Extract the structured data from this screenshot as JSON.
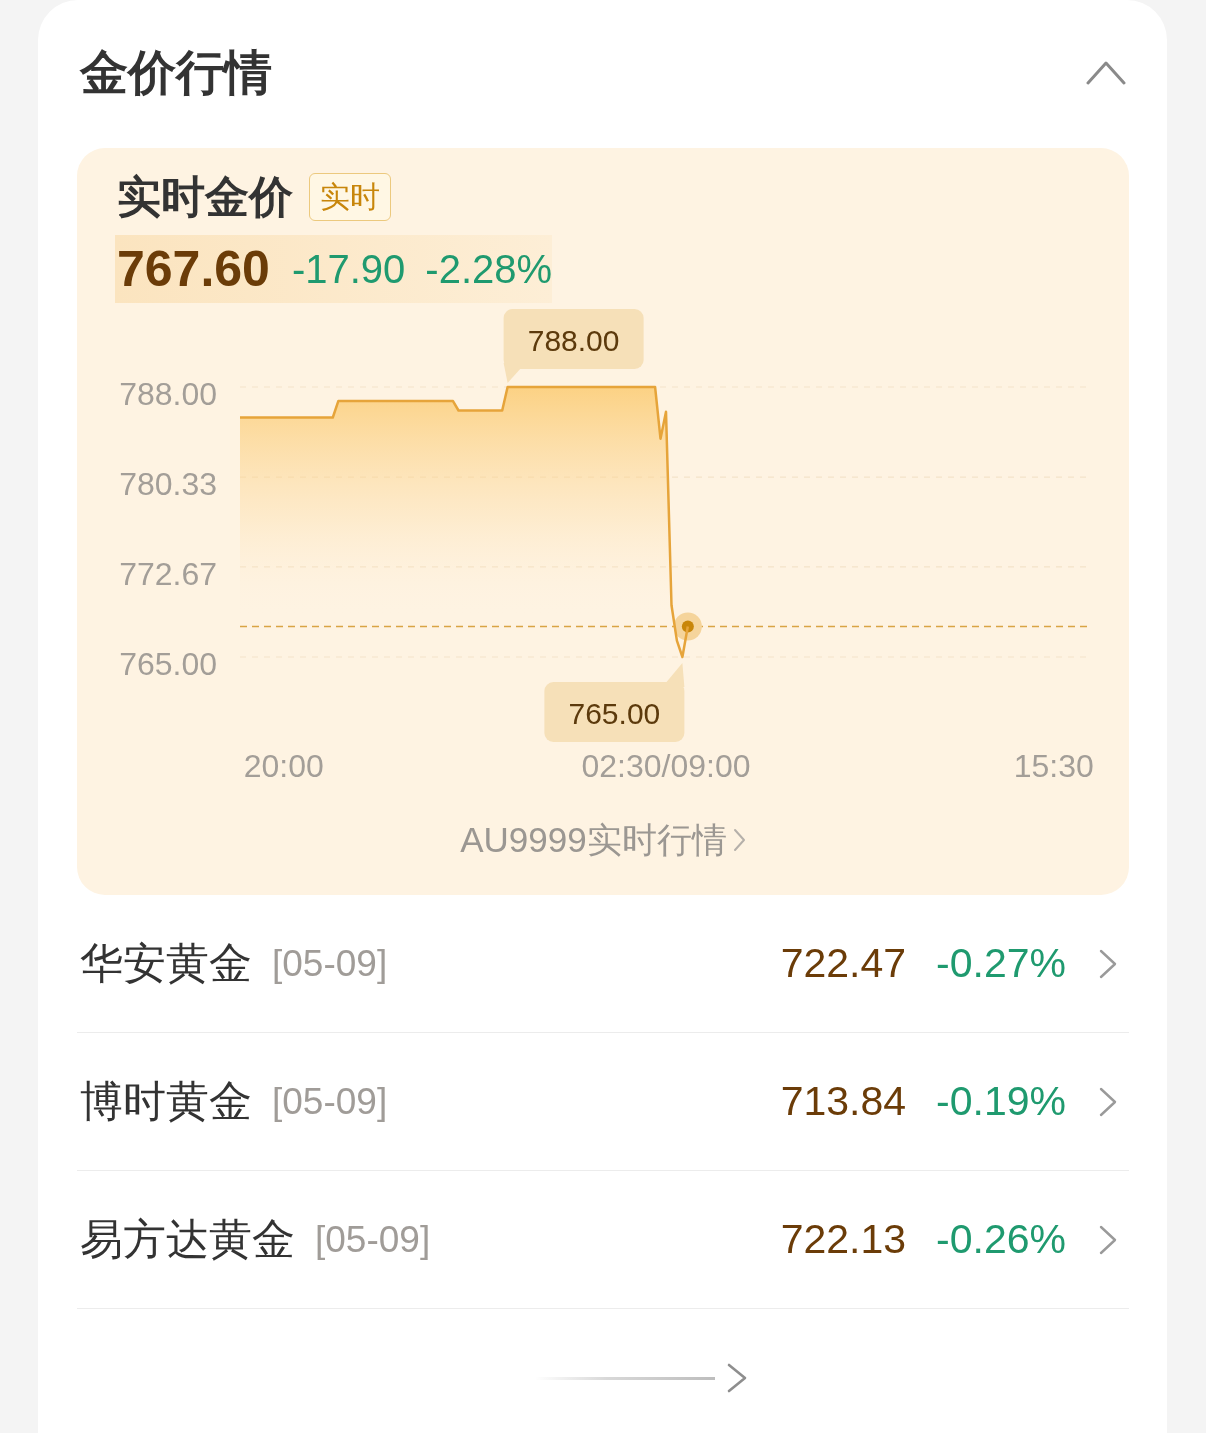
{
  "section": {
    "title": "金价行情",
    "expanded": true
  },
  "realtime": {
    "title": "实时金价",
    "badge": "实时",
    "price": "767.60",
    "change": "-17.90",
    "change_percent": "-2.28%",
    "chart_data": {
      "type": "area",
      "categories": [
        null,
        null,
        null,
        null,
        null,
        null,
        null,
        null,
        "20:00",
        null,
        null,
        null,
        null,
        null,
        null,
        null,
        null,
        null,
        null,
        null,
        null,
        null,
        null,
        null,
        null,
        null,
        null,
        null,
        null,
        null,
        null,
        null,
        null,
        null,
        null,
        null,
        null,
        null,
        null,
        null,
        null,
        null,
        null,
        null,
        null,
        null,
        null,
        null,
        null,
        null,
        null,
        null,
        null,
        null,
        null,
        null,
        null,
        null,
        null,
        null,
        null,
        null,
        null,
        null,
        null,
        null,
        null,
        null,
        null,
        null,
        null,
        null,
        null,
        null,
        null,
        null,
        null,
        null,
        "02:30/09:00",
        null,
        null,
        null,
        null,
        null,
        null,
        null,
        null,
        null,
        null,
        null,
        null,
        null,
        null,
        null,
        null,
        null,
        null,
        null,
        null,
        null,
        null,
        null,
        null,
        null,
        null,
        null,
        null,
        null,
        null,
        null,
        null,
        null,
        null,
        null,
        null,
        null,
        null,
        null,
        null,
        null,
        null,
        null,
        null,
        null,
        null,
        null,
        null,
        null,
        null,
        null,
        null,
        null,
        null,
        null,
        null,
        null,
        null,
        null,
        null,
        null,
        null,
        null,
        null,
        null,
        null,
        null,
        null,
        null,
        null,
        "15:30",
        null,
        null,
        null,
        null,
        null,
        null,
        null
      ],
      "series": [
        {
          "color": "#e6a43a",
          "values": [
            785.4,
            785.4,
            785.4,
            785.4,
            785.4,
            785.4,
            785.4,
            785.4,
            785.4,
            785.4,
            785.4,
            785.4,
            785.4,
            785.4,
            785.4,
            785.4,
            785.4,
            785.4,
            786.8,
            786.8,
            786.8,
            786.8,
            786.8,
            786.8,
            786.8,
            786.8,
            786.8,
            786.8,
            786.8,
            786.8,
            786.8,
            786.8,
            786.8,
            786.8,
            786.8,
            786.8,
            786.8,
            786.8,
            786.8,
            786.8,
            786.0,
            786.0,
            786.0,
            786.0,
            786.0,
            786.0,
            786.0,
            786.0,
            786.0,
            788.0,
            788.0,
            788.0,
            788.0,
            788.0,
            788.0,
            788.0,
            788.0,
            788.0,
            788.0,
            788.0,
            788.0,
            788.0,
            788.0,
            788.0,
            788.0,
            788.0,
            788.0,
            788.0,
            788.0,
            788.0,
            788.0,
            788.0,
            788.0,
            788.0,
            788.0,
            788.0,
            788.0,
            783.6,
            785.9,
            769.4,
            766.4,
            765.0,
            767.6,
            null,
            null,
            null,
            null,
            null,
            null,
            null,
            null,
            null,
            null,
            null,
            null,
            null,
            null,
            null,
            null,
            null,
            null,
            null,
            null,
            null,
            null,
            null,
            null,
            null,
            null,
            null,
            null,
            null,
            null,
            null,
            null,
            null,
            null,
            null,
            null,
            null,
            null,
            null,
            null,
            null,
            null,
            null,
            null,
            null,
            null,
            null,
            null,
            null,
            null,
            null,
            null,
            null,
            null,
            null,
            null,
            null,
            null,
            null,
            null,
            null,
            null,
            null,
            null,
            null,
            null,
            null,
            null,
            null,
            null,
            null,
            null,
            null,
            null
          ]
        }
      ],
      "ylim": [
        765,
        788
      ],
      "yticks": [
        {
          "value": 788,
          "label": "788.00"
        },
        {
          "value": 780.33,
          "label": "780.33"
        },
        {
          "value": 772.67,
          "label": "772.67"
        },
        {
          "value": 765,
          "label": "765.00"
        }
      ],
      "annotations": [
        {
          "y": 788,
          "text": "788.00"
        },
        {
          "y": 765,
          "text": "765.00"
        }
      ],
      "ref_lines": [
        {
          "axis": "y",
          "value": 767.6
        }
      ]
    },
    "link": "AU9999实时行情"
  },
  "funds": [
    {
      "name": "华安黄金",
      "date": "[05-09]",
      "price": "722.47",
      "change": "-0.27%"
    },
    {
      "name": "博时黄金",
      "date": "[05-09]",
      "price": "713.84",
      "change": "-0.19%"
    },
    {
      "name": "易方达黄金",
      "date": "[05-09]",
      "price": "722.13",
      "change": "-0.26%"
    }
  ]
}
